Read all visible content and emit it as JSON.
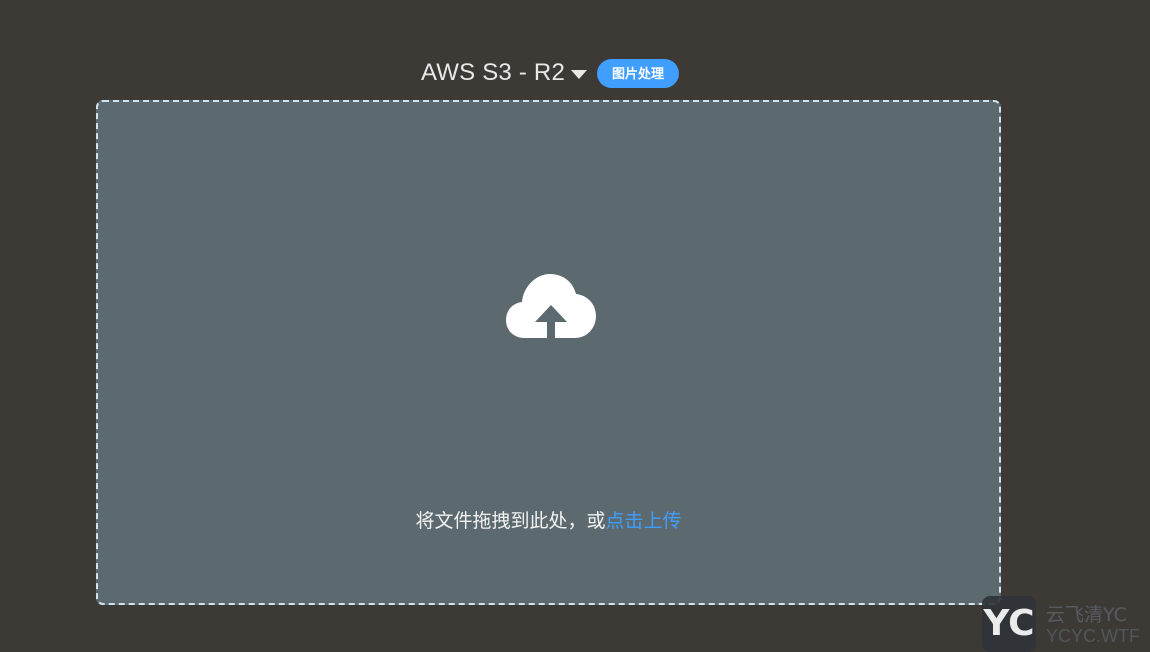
{
  "header": {
    "storage_name": "AWS S3 - R2",
    "dropdown_icon": "caret-down-icon",
    "image_processing_tag": "图片处理"
  },
  "dropzone": {
    "icon": "cloud-upload-icon",
    "hint_text": "将文件拖拽到此处，或",
    "click_upload_link": "点击上传"
  },
  "watermark": {
    "logo_text": "YC",
    "line1": "云飞清YC",
    "line2": "YCYC.WTF"
  },
  "colors": {
    "background": "#3d3a36",
    "dropzone_bg": "#5c6a70",
    "accent": "#409eff",
    "dashed_border": "#cfe4f1"
  }
}
